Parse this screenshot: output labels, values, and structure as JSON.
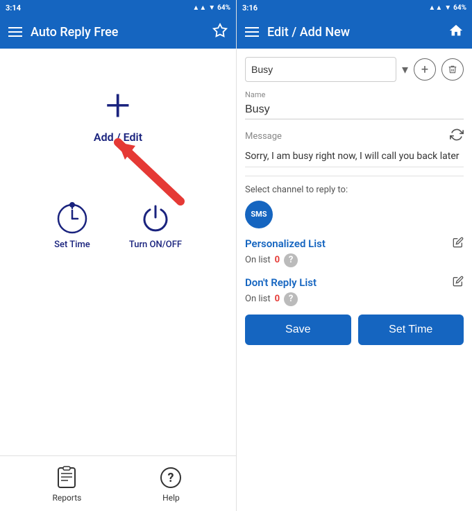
{
  "left": {
    "status": {
      "time": "3:14",
      "battery": "64%"
    },
    "appBar": {
      "title": "Auto Reply Free",
      "menuIcon": "☰"
    },
    "addEdit": {
      "plusSymbol": "+",
      "label": "Add / Edit"
    },
    "bottomIcons": [
      {
        "id": "set-time",
        "label": "Set Time"
      },
      {
        "id": "turn-on-off",
        "label": "Turn ON/OFF"
      }
    ],
    "footer": [
      {
        "id": "reports",
        "label": "Reports"
      },
      {
        "id": "help",
        "label": "Help"
      }
    ]
  },
  "right": {
    "status": {
      "time": "3:16",
      "battery": "64%"
    },
    "appBar": {
      "title": "Edit / Add New"
    },
    "form": {
      "selectedProfile": "Busy",
      "nameLabel": "Name",
      "nameValue": "Busy",
      "messageLabel": "Message",
      "messageValue": "Sorry, I am busy right now, I will call you back later",
      "channelLabel": "Select channel to reply to:",
      "smsBadge": "SMS",
      "personalizedList": {
        "title": "Personalized List",
        "onListLabel": "On list",
        "count": "0"
      },
      "dontReplyList": {
        "title": "Don't Reply List",
        "onListLabel": "On list",
        "count": "0"
      },
      "saveButton": "Save",
      "setTimeButton": "Set Time"
    }
  }
}
